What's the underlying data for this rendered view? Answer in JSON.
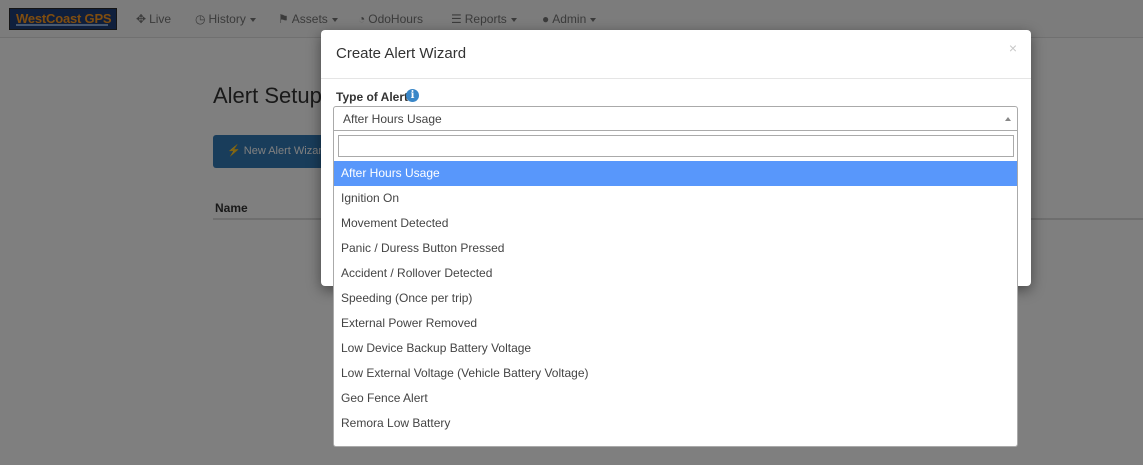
{
  "navbar": {
    "brand": "WestCoast GPS",
    "items": [
      {
        "label": "Live",
        "icon": "move-icon",
        "glyph": "✥",
        "dropdown": false
      },
      {
        "label": "History",
        "icon": "clock-icon",
        "glyph": "◷",
        "dropdown": true
      },
      {
        "label": "Assets",
        "icon": "flag-icon",
        "glyph": "⚑",
        "dropdown": true
      },
      {
        "label": "OdoHours",
        "icon": "dashboard-icon",
        "glyph": "◔",
        "dropdown": false
      },
      {
        "label": "Reports",
        "icon": "list-icon",
        "glyph": "☰",
        "dropdown": true
      },
      {
        "label": "Admin",
        "icon": "user-icon",
        "glyph": "●",
        "dropdown": true
      }
    ]
  },
  "page": {
    "title": "Alert Setup",
    "new_alert_button": "New Alert Wizard",
    "table_header_name": "Name"
  },
  "modal": {
    "title": "Create Alert Wizard",
    "close": "×",
    "field_label": "Type of Alert",
    "info_glyph": "i",
    "selected_value": "After Hours Usage",
    "search_value": "",
    "options": [
      "After Hours Usage",
      "Ignition On",
      "Movement Detected",
      "Panic / Duress Button Pressed",
      "Accident / Rollover Detected",
      "Speeding (Once per trip)",
      "External Power Removed",
      "Low Device Backup Battery Voltage",
      "Low External Voltage (Vehicle Battery Voltage)",
      "Geo Fence Alert",
      "Remora Low Battery"
    ],
    "selected_index": 0
  },
  "colors": {
    "primary": "#337ab7",
    "highlight": "#5897fb",
    "brand_bg": "#1f3f79",
    "brand_text": "#ff9a1f"
  }
}
